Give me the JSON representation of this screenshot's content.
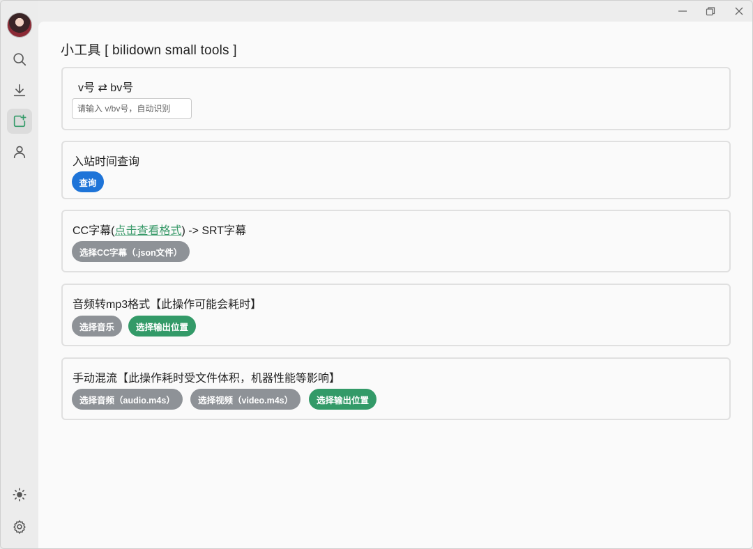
{
  "window": {
    "controls": [
      "minimize",
      "restore",
      "close"
    ]
  },
  "sidebar": {
    "items": [
      {
        "name": "search",
        "icon": "search-icon"
      },
      {
        "name": "download",
        "icon": "download-icon"
      },
      {
        "name": "tools",
        "icon": "tools-icon",
        "active": true
      },
      {
        "name": "user",
        "icon": "user-icon"
      }
    ],
    "bottom": [
      {
        "name": "theme",
        "icon": "sun-icon"
      },
      {
        "name": "settings",
        "icon": "gear-icon"
      }
    ]
  },
  "page": {
    "title": "小工具 [ bilidown small tools ]"
  },
  "cards": {
    "av_bv": {
      "title": "v号 ⇄ bv号",
      "input_placeholder": "请输入 v/bv号，自动识别"
    },
    "join_time": {
      "title": "入站时间查询",
      "button": "查询"
    },
    "cc_srt": {
      "title_prefix": "CC字幕(",
      "link_text": "点击查看格式",
      "title_suffix": ") -> SRT字幕",
      "button": "选择CC字幕（.json文件）"
    },
    "to_mp3": {
      "title": "音频转mp3格式【此操作可能会耗时】",
      "button_music": "选择音乐",
      "button_output": "选择输出位置"
    },
    "mux": {
      "title": "手动混流【此操作耗时受文件体积，机器性能等影响】",
      "button_audio": "选择音频（audio.m4s）",
      "button_video": "选择视频（video.m4s）",
      "button_output": "选择输出位置"
    }
  },
  "colors": {
    "accent_green": "#339a68",
    "primary_blue": "#1e74d8",
    "neutral_gray": "#8e9297"
  }
}
